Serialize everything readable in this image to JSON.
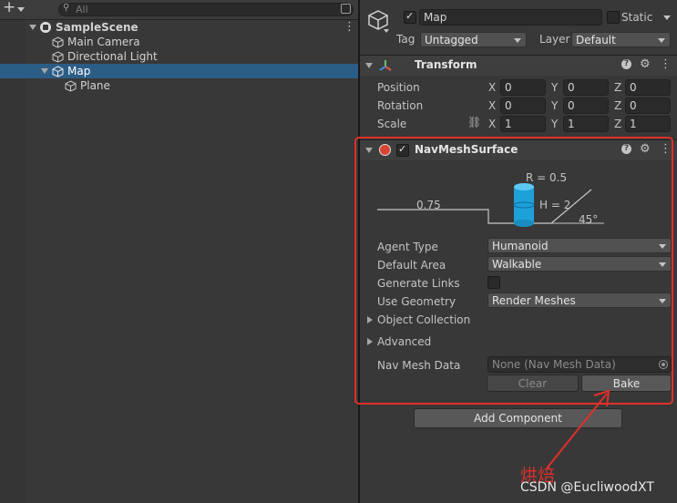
{
  "hierarchy": {
    "search_placeholder": "All",
    "items": [
      {
        "label": "SampleScene"
      },
      {
        "label": "Main Camera"
      },
      {
        "label": "Directional Light"
      },
      {
        "label": "Map"
      },
      {
        "label": "Plane"
      }
    ]
  },
  "inspector": {
    "object_name": "Map",
    "static_label": "Static",
    "tag_label": "Tag",
    "tag_value": "Untagged",
    "layer_label": "Layer",
    "layer_value": "Default",
    "transform": {
      "title": "Transform",
      "rows": [
        {
          "label": "Position",
          "x": "0",
          "y": "0",
          "z": "0"
        },
        {
          "label": "Rotation",
          "x": "0",
          "y": "0",
          "z": "0"
        },
        {
          "label": "Scale",
          "x": "1",
          "y": "1",
          "z": "1"
        }
      ],
      "axis_x": "X",
      "axis_y": "Y",
      "axis_z": "Z"
    },
    "navmesh": {
      "title": "NavMeshSurface",
      "diagram": {
        "radius": "R = 0.5",
        "step": "0.75",
        "height": "H = 2",
        "slope": "45°"
      },
      "agent_type_label": "Agent Type",
      "agent_type_value": "Humanoid",
      "default_area_label": "Default Area",
      "default_area_value": "Walkable",
      "generate_links_label": "Generate Links",
      "use_geometry_label": "Use Geometry",
      "use_geometry_value": "Render Meshes",
      "object_collection_label": "Object Collection",
      "advanced_label": "Advanced",
      "navmesh_data_label": "Nav Mesh Data",
      "navmesh_data_value": "None (Nav Mesh Data)",
      "clear_label": "Clear",
      "bake_label": "Bake"
    },
    "add_component_label": "Add Component"
  },
  "annotation": {
    "text": "烘焙",
    "color": "#e0302a"
  },
  "watermark": "CSDN @EucliwoodXT",
  "colors": {
    "selection": "#2c5d87",
    "highlight": "#e0302a",
    "cylinder": "#1ea0d8"
  }
}
